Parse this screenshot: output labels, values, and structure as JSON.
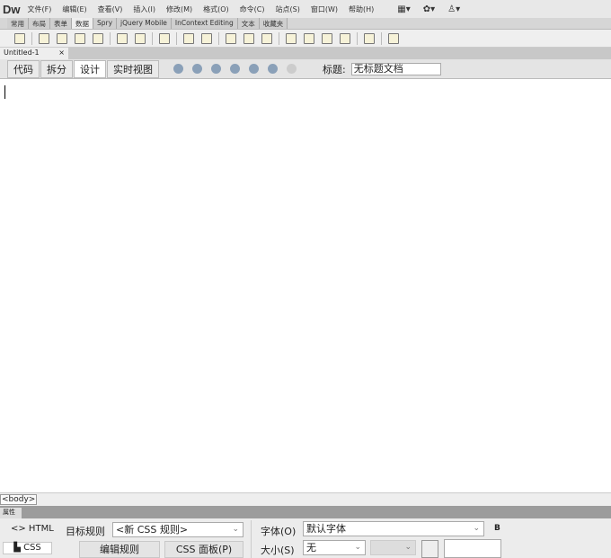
{
  "app": {
    "logo": "Dw"
  },
  "menu": [
    "文件(F)",
    "编辑(E)",
    "查看(V)",
    "插入(I)",
    "修改(M)",
    "格式(O)",
    "命令(C)",
    "站点(S)",
    "窗口(W)",
    "帮助(H)"
  ],
  "insert_tabs": [
    "常用",
    "布局",
    "表单",
    "数据",
    "Spry",
    "jQuery Mobile",
    "InContext Editing",
    "文本",
    "收藏夹"
  ],
  "active_insert_tab": "数据",
  "document_tab": {
    "name": "Untitled-1",
    "close": "×"
  },
  "views": [
    "代码",
    "拆分",
    "设计",
    "实时视图"
  ],
  "active_view": "设计",
  "title_label": "标题:",
  "title_value": "无标题文档",
  "tag_selector": "<body>",
  "properties": {
    "panel_label": "属性",
    "html_button": "<> HTML",
    "css_button": "CSS",
    "target_rule_label": "目标规则",
    "target_rule_value": "<新 CSS 规则>",
    "edit_rule": "编辑规则",
    "css_panel": "CSS 面板(P)",
    "font_label": "字体(O)",
    "font_value": "默认字体",
    "bold": "B",
    "size_label": "大小(S)",
    "size_value": "无"
  }
}
